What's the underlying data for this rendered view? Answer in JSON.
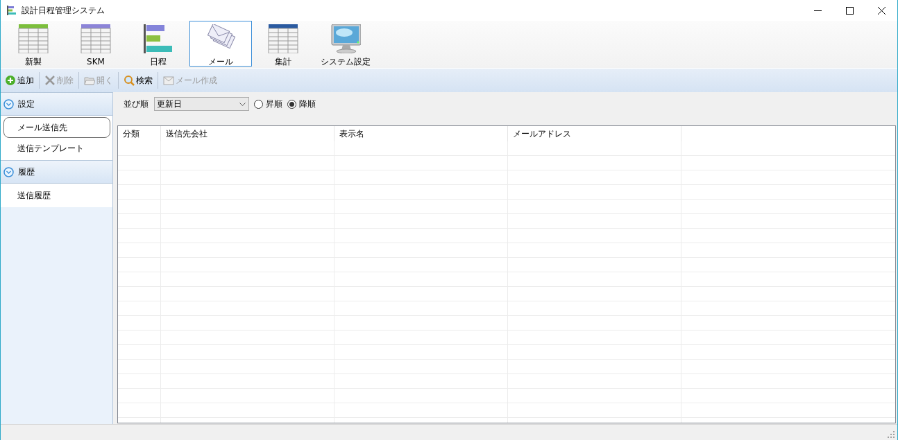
{
  "window": {
    "title": "設計日程管理システム"
  },
  "ribbon": [
    {
      "label": "新製",
      "kind": "green-table",
      "selected": false
    },
    {
      "label": "SKM",
      "kind": "purple-table",
      "selected": false
    },
    {
      "label": "日程",
      "kind": "schedule",
      "selected": false
    },
    {
      "label": "メール",
      "kind": "mail",
      "selected": true
    },
    {
      "label": "集計",
      "kind": "blue-table",
      "selected": false
    },
    {
      "label": "システム設定",
      "kind": "monitor",
      "selected": false
    }
  ],
  "toolbar": [
    {
      "label": "追加",
      "kind": "add",
      "disabled": false
    },
    {
      "label": "削除",
      "kind": "delete",
      "disabled": true
    },
    {
      "label": "開く",
      "kind": "open",
      "disabled": true
    },
    {
      "label": "検索",
      "kind": "search",
      "disabled": false
    },
    {
      "label": "メール作成",
      "kind": "compose",
      "disabled": true
    }
  ],
  "sidebar": {
    "groups": [
      {
        "title": "設定",
        "expanded": true,
        "items": [
          {
            "label": "メール送信先",
            "selected": true
          },
          {
            "label": "送信テンプレート",
            "selected": false
          }
        ]
      },
      {
        "title": "履歴",
        "expanded": true,
        "items": [
          {
            "label": "送信履歴",
            "selected": false
          }
        ]
      }
    ]
  },
  "sort": {
    "label": "並び順",
    "value": "更新日",
    "options": [
      {
        "label": "昇順",
        "selected": false
      },
      {
        "label": "降順",
        "selected": true
      }
    ]
  },
  "table": {
    "columns": [
      "分類",
      "送信先会社",
      "表示名",
      "メールアドレス"
    ]
  }
}
